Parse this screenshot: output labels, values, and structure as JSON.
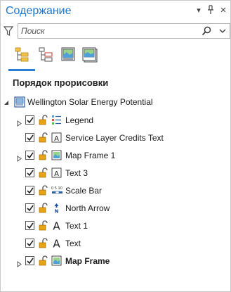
{
  "panel": {
    "title": "Содержание",
    "menu_glyph": "▾",
    "pin_glyph": "⊥",
    "close_glyph": "✕"
  },
  "search": {
    "placeholder": "Поиск",
    "value": ""
  },
  "view_tabs": [
    {
      "id": "drawing-order",
      "icon": "drawing-order-icon",
      "active": true
    },
    {
      "id": "selection",
      "icon": "selection-icon",
      "active": false
    },
    {
      "id": "map-frames",
      "icon": "map-frames-icon",
      "active": false
    },
    {
      "id": "tables",
      "icon": "tables-icon",
      "active": false
    }
  ],
  "section_title": "Порядок прорисовки",
  "layout": {
    "name": "Wellington Solar Energy Potential",
    "expanded": true,
    "icon": "layout-icon"
  },
  "elements": [
    {
      "label": "Legend",
      "icon": "legend-icon",
      "expandable": true,
      "checked": true,
      "bold": false
    },
    {
      "label": "Service Layer Credits Text",
      "icon": "dynamic-text-icon",
      "expandable": false,
      "checked": true,
      "bold": false
    },
    {
      "label": "Map Frame 1",
      "icon": "map-frame-icon",
      "expandable": true,
      "checked": true,
      "bold": false
    },
    {
      "label": "Text 3",
      "icon": "dynamic-text-icon",
      "expandable": false,
      "checked": true,
      "bold": false
    },
    {
      "label": "Scale Bar",
      "icon": "scale-bar-icon",
      "expandable": false,
      "checked": true,
      "bold": false
    },
    {
      "label": "North Arrow",
      "icon": "north-arrow-icon",
      "expandable": false,
      "checked": true,
      "bold": false
    },
    {
      "label": "Text 1",
      "icon": "text-icon",
      "expandable": false,
      "checked": true,
      "bold": false
    },
    {
      "label": "Text",
      "icon": "text-icon",
      "expandable": false,
      "checked": true,
      "bold": false
    },
    {
      "label": "Map Frame",
      "icon": "map-frame-icon",
      "expandable": true,
      "checked": true,
      "bold": true
    }
  ],
  "colors": {
    "accent": "#2a7fd4",
    "title": "#2277c8",
    "lock": "#e8a317",
    "north_arrow": "#1f4e9c"
  }
}
